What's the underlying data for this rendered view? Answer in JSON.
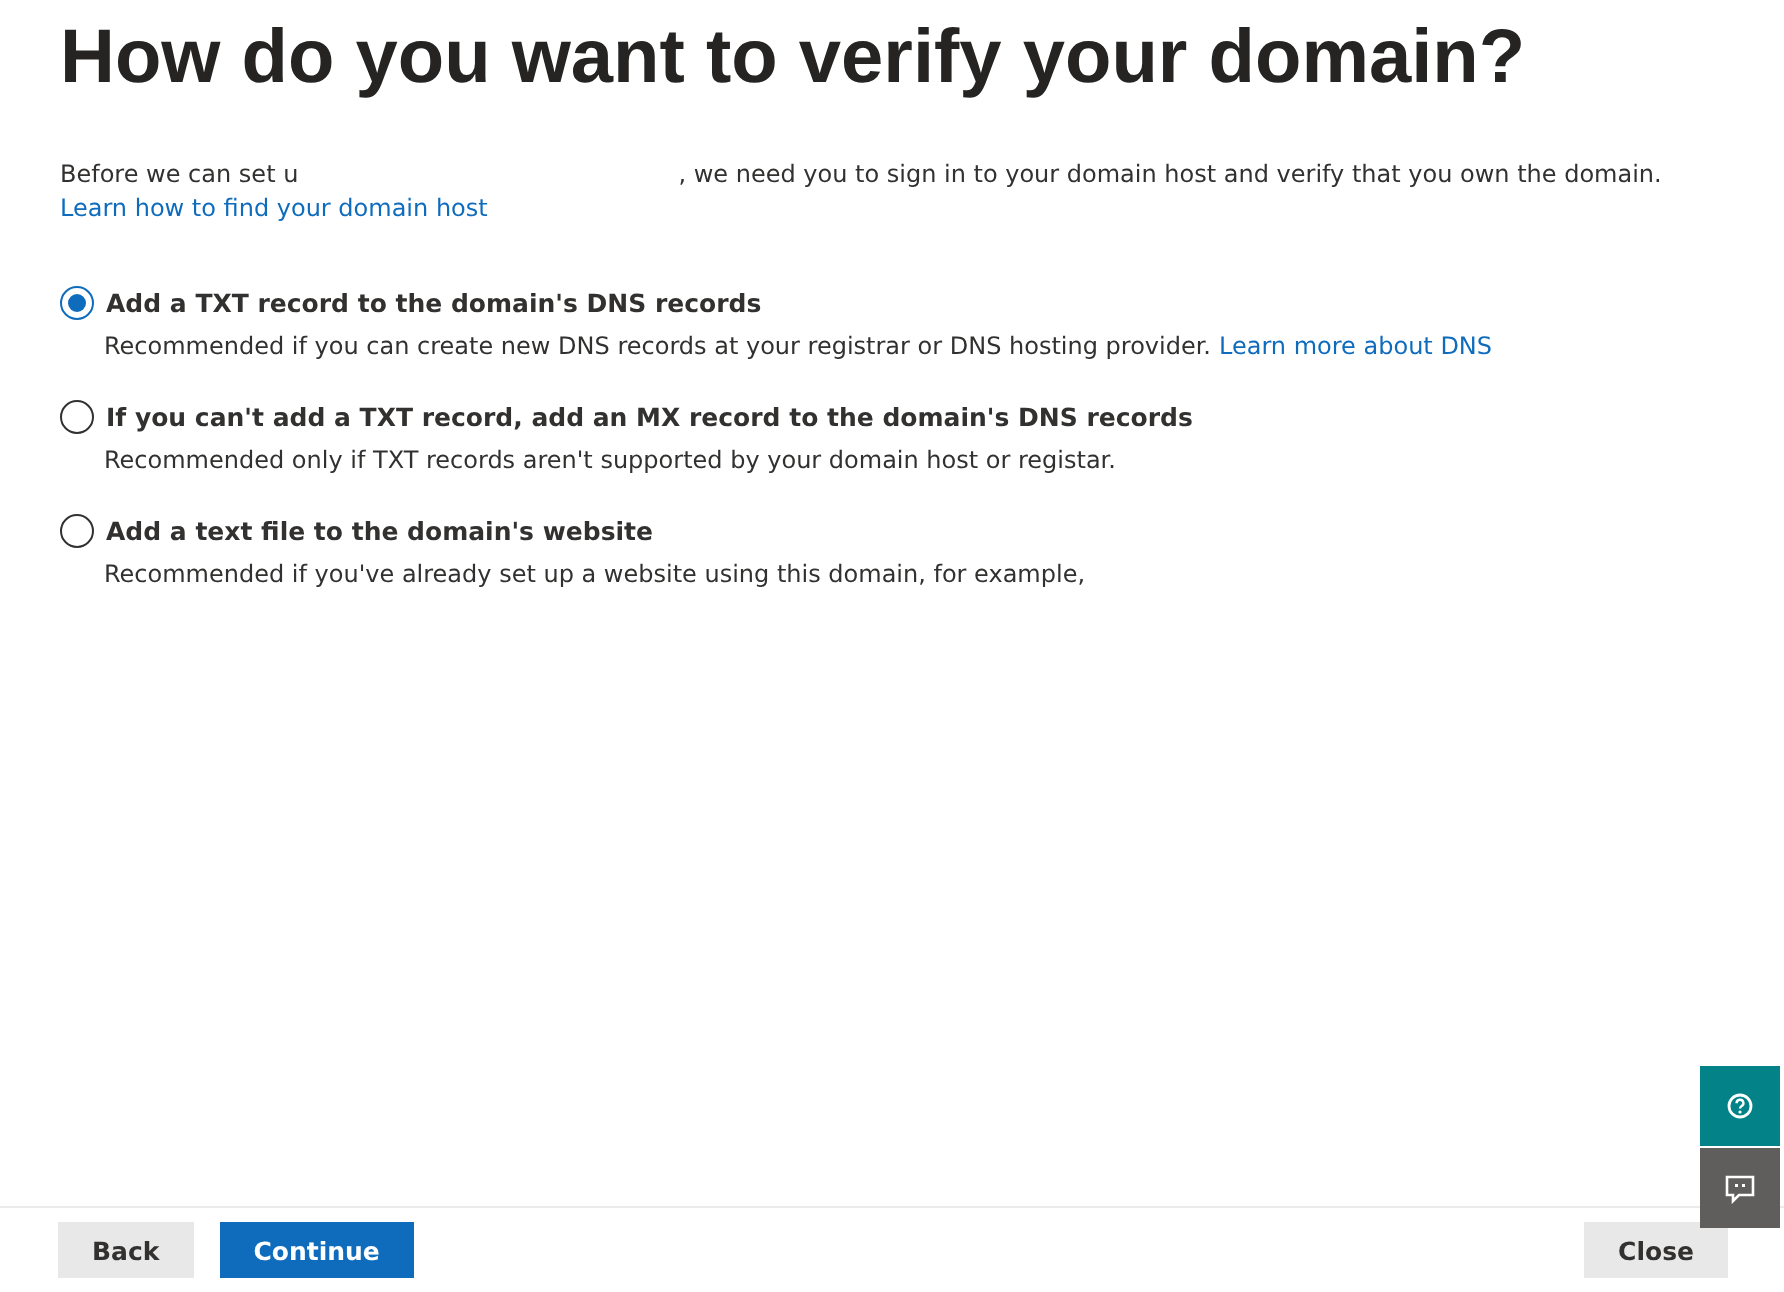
{
  "title": "How do you want to verify your domain?",
  "intro": {
    "before": "Before we can set u",
    "after": ", we need you to sign in to your domain host and verify that you own the domain.",
    "link": "Learn how to find your domain host"
  },
  "options": [
    {
      "label": "Add a TXT record to the domain's DNS records",
      "description": "Recommended if you can create new DNS records at your registrar or DNS hosting provider.",
      "link": "Learn more about DNS",
      "selected": true
    },
    {
      "label": "If you can't add a TXT record, add an MX record to the domain's DNS records",
      "description": "Recommended only if TXT records aren't supported by your domain host or registar.",
      "selected": false
    },
    {
      "label": "Add a text file to the domain's website",
      "description": "Recommended if you've already set up a website using this domain, for example,",
      "selected": false
    }
  ],
  "buttons": {
    "back": "Back",
    "continue": "Continue",
    "close": "Close"
  }
}
